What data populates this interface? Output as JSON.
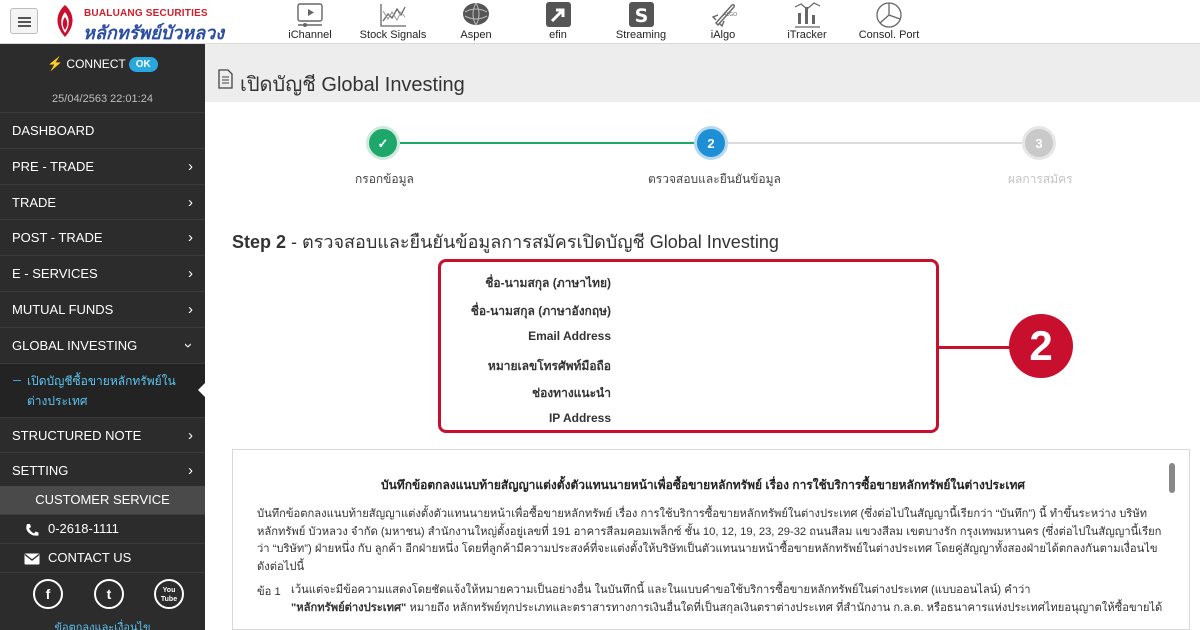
{
  "brand": {
    "name_en": "BUALUANG SECURITIES",
    "name_th": "หลักทรัพย์บัวหลวง",
    "primary_color": "#c8102e",
    "accent_color": "#29a8e0"
  },
  "topnav": [
    {
      "label": "iChannel",
      "icon": "video-player-icon"
    },
    {
      "label": "Stock Signals",
      "icon": "signal-chart-icon"
    },
    {
      "label": "Aspen",
      "icon": "globe-icon"
    },
    {
      "label": "efin",
      "icon": "efin-arrow-icon"
    },
    {
      "label": "Streaming",
      "icon": "streaming-s-icon"
    },
    {
      "label": "iAlgo",
      "icon": "rocket-icon"
    },
    {
      "label": "iTracker",
      "icon": "tracker-chart-icon"
    },
    {
      "label": "Consol. Port",
      "icon": "pie-chart-icon"
    }
  ],
  "sidebar": {
    "connect_label": "CONNECT",
    "connect_status": "OK",
    "datetime": "25/04/2563 22:01:24",
    "menu": [
      {
        "label": "DASHBOARD"
      },
      {
        "label": "PRE - TRADE"
      },
      {
        "label": "TRADE"
      },
      {
        "label": "POST - TRADE"
      },
      {
        "label": "E - SERVICES"
      },
      {
        "label": "MUTUAL FUNDS"
      },
      {
        "label": "GLOBAL INVESTING"
      },
      {
        "label": "STRUCTURED NOTE"
      },
      {
        "label": "SETTING"
      }
    ],
    "submenu_active": "เปิดบัญชีซื้อขายหลักทรัพย์ในต่างประเทศ",
    "customer_service": {
      "title": "CUSTOMER SERVICE",
      "phone": "0-2618-1111",
      "contact": "CONTACT US"
    },
    "social": [
      {
        "glyph": "f",
        "icon": "facebook-icon"
      },
      {
        "glyph": "t",
        "icon": "twitter-icon"
      },
      {
        "glyph": "You Tube",
        "icon": "youtube-icon"
      }
    ],
    "terms_link": "ข้อตกลงและเงื่อนไข"
  },
  "page": {
    "title": "เปิดบัญชี Global Investing"
  },
  "steps": [
    {
      "number": "✓",
      "label": "กรอกข้อมูล",
      "state": "done"
    },
    {
      "number": "2",
      "label": "ตรวจสอบและยืนยันข้อมูล",
      "state": "active"
    },
    {
      "number": "3",
      "label": "ผลการสมัคร",
      "state": "pending"
    }
  ],
  "step_heading": {
    "prefix": "Step 2",
    "text": " - ตรวจสอบและยืนยันข้อมูลการสมัครเปิดบัญชี Global Investing"
  },
  "info_fields": [
    {
      "label": "ชื่อ-นามสกุล (ภาษาไทย)",
      "value": ""
    },
    {
      "label": "ชื่อ-นามสกุล (ภาษาอังกฤษ)",
      "value": ""
    },
    {
      "label": "Email Address",
      "value": ""
    },
    {
      "label": "หมายเลขโทรศัพท์มือถือ",
      "value": ""
    },
    {
      "label": "ช่องทางแนะนำ",
      "value": ""
    },
    {
      "label": "IP Address",
      "value": ""
    }
  ],
  "callout_number": "2",
  "agreement": {
    "title": "บันทึกข้อตกลงแนบท้ายสัญญาแต่งตั้งตัวแทนนายหน้าเพื่อซื้อขายหลักทรัพย์ เรื่อง การใช้บริการซื้อขายหลักทรัพย์ในต่างประเทศ",
    "paragraph": "บันทึกข้อตกลงแนบท้ายสัญญาแต่งตั้งตัวแทนนายหน้าเพื่อซื้อขายหลักทรัพย์ เรื่อง การใช้บริการซื้อขายหลักทรัพย์ในต่างประเทศ (ซึ่งต่อไปในสัญญานี้เรียกว่า “บันทึก”) นี้ ทำขึ้นระหว่าง บริษัทหลักทรัพย์ บัวหลวง จำกัด (มหาชน) สำนักงานใหญ่ตั้งอยู่เลขที่ 191 อาคารสีลมคอมเพล็กซ์ ชั้น 10, 12, 19, 23, 29-32 ถนนสีลม แขวงสีลม เขตบางรัก กรุงเทพมหานคร (ซึ่งต่อไปในสัญญานี้เรียกว่า “บริษัท”) ฝ่ายหนึ่ง กับ ลูกค้า อีกฝ่ายหนึ่ง โดยที่ลูกค้ามีความประสงค์ที่จะแต่งตั้งให้บริษัทเป็นตัวแทนนายหน้าซื้อขายหลักทรัพย์ในต่างประเทศ โดยคู่สัญญาทั้งสองฝ่ายได้ตกลงกันตามเงื่อนไขดังต่อไปนี้",
    "clause_no": "ข้อ 1",
    "clause_intro": "เว้นแต่จะมีข้อความแสดงโดยชัดแจ้งให้หมายความเป็นอย่างอื่น ในบันทึกนี้ และในแบบคำขอใช้บริการซื้อขายหลักทรัพย์ในต่างประเทศ (แบบออนไลน์) คำว่า",
    "clause_term": "\"หลักทรัพย์ต่างประเทศ\"",
    "clause_def": " หมายถึง หลักทรัพย์ทุกประเภทและตราสารทางการเงินอื่นใดที่เป็นสกุลเงินตราต่างประเทศ ที่สำนักงาน ก.ล.ต. หรือธนาคารแห่งประเทศไทยอนุญาตให้ซื้อขายได้"
  }
}
